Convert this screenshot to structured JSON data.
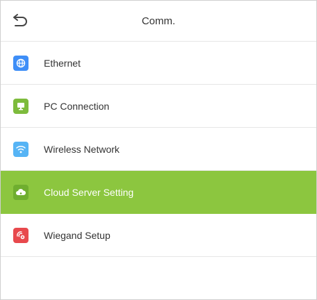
{
  "header": {
    "title": "Comm.",
    "back_icon": "back-arrow-icon"
  },
  "colors": {
    "selected_row": "#8cc63f",
    "ethernet_icon": "#3e8ef7",
    "pc_connection_icon": "#7dbb3c",
    "wireless_icon": "#56b4f5",
    "cloud_icon": "#6fae2f",
    "wiegand_icon": "#e8494d"
  },
  "menu": {
    "items": [
      {
        "label": "Ethernet",
        "icon": "globe-icon",
        "selected": false
      },
      {
        "label": "PC Connection",
        "icon": "monitor-icon",
        "selected": false
      },
      {
        "label": "Wireless Network",
        "icon": "wifi-icon",
        "selected": false
      },
      {
        "label": "Cloud Server Setting",
        "icon": "cloud-icon",
        "selected": true
      },
      {
        "label": "Wiegand Setup",
        "icon": "wiegand-icon",
        "selected": false
      }
    ]
  }
}
